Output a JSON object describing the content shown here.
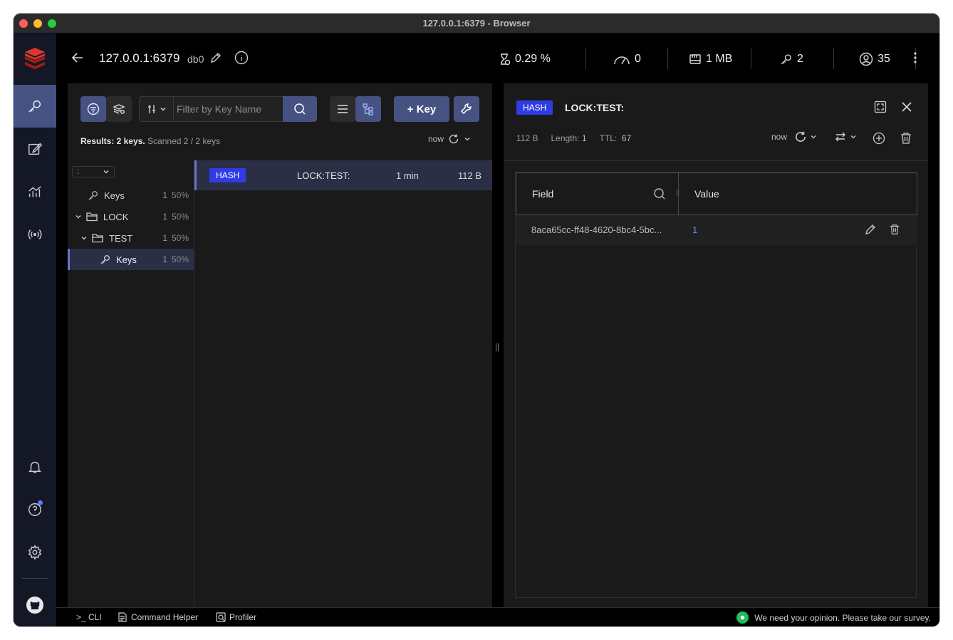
{
  "window": {
    "title": "127.0.0.1:6379 - Browser"
  },
  "header": {
    "host": "127.0.0.1:6379",
    "db": "db0",
    "stats": {
      "cpu": "0.29 %",
      "ops": "0",
      "memory": "1 MB",
      "keys": "2",
      "clients": "35"
    }
  },
  "browser": {
    "filter_placeholder": "Filter by Key Name",
    "add_key_label": "+ Key",
    "results_bold": "Results: 2 keys.",
    "results_rest": " Scanned 2 / 2 keys",
    "refresh_label": "now",
    "delimiter": ":",
    "tree": [
      {
        "label": "Keys",
        "count": "1",
        "pct": "50%"
      },
      {
        "label": "LOCK",
        "count": "1",
        "pct": "50%"
      },
      {
        "label": "TEST",
        "count": "1",
        "pct": "50%"
      },
      {
        "label": "Keys",
        "count": "1",
        "pct": "50%"
      }
    ],
    "keys": [
      {
        "type": "HASH",
        "name": "LOCK:TEST:",
        "ttl": "1 min",
        "size": "112 B"
      }
    ]
  },
  "details": {
    "type": "HASH",
    "name": "LOCK:TEST:",
    "size": "112 B",
    "length_label": "Length:",
    "length": "1",
    "ttl_label": "TTL:",
    "ttl": "67",
    "refresh_label": "now",
    "columns": {
      "field": "Field",
      "value": "Value"
    },
    "rows": [
      {
        "field": "8aca65cc-ff48-4620-8bc4-5bc...",
        "value": "1"
      }
    ]
  },
  "bottombar": {
    "cli": ">_ CLI",
    "command_helper": "Command Helper",
    "profiler": "Profiler",
    "survey": "We need your opinion. Please take our survey."
  },
  "colors": {
    "accent": "#465282",
    "badge_hash": "#2f3ce6",
    "link": "#5b8cff",
    "survey_green": "#1fbd5a"
  }
}
